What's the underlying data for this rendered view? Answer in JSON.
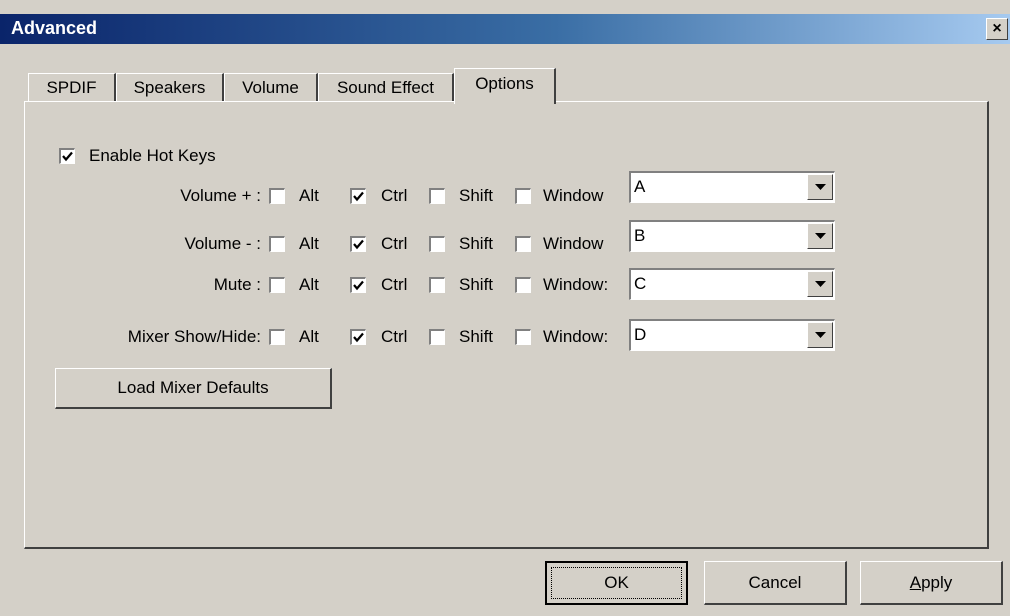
{
  "window": {
    "title": "Advanced",
    "close_glyph": "×"
  },
  "tabs": [
    {
      "label": "SPDIF",
      "active": false
    },
    {
      "label": "Speakers",
      "active": false
    },
    {
      "label": "Volume",
      "active": false
    },
    {
      "label": "Sound Effect",
      "active": false
    },
    {
      "label": "Options",
      "active": true
    }
  ],
  "options": {
    "enable_hot_keys": {
      "label": "Enable Hot Keys",
      "checked": true
    },
    "modifier_labels": {
      "alt": "Alt",
      "ctrl": "Ctrl",
      "shift": "Shift"
    },
    "rows": [
      {
        "label": "Volume + :",
        "alt": false,
        "ctrl": true,
        "shift": false,
        "window": false,
        "window_label": "Window",
        "key": "A"
      },
      {
        "label": "Volume - :",
        "alt": false,
        "ctrl": true,
        "shift": false,
        "window": false,
        "window_label": "Window",
        "key": "B"
      },
      {
        "label": "Mute :",
        "alt": false,
        "ctrl": true,
        "shift": false,
        "window": false,
        "window_label": "Window:",
        "key": "C"
      },
      {
        "label": "Mixer Show/Hide:",
        "alt": false,
        "ctrl": true,
        "shift": false,
        "window": false,
        "window_label": "Window:",
        "key": "D"
      }
    ],
    "load_defaults_label": "Load Mixer Defaults"
  },
  "footer": {
    "ok_label": "OK",
    "cancel_label": "Cancel",
    "apply_accel": "A",
    "apply_rest": "pply"
  },
  "colors": {
    "face": "#d4d0c8",
    "title_start": "#0a246a",
    "title_end": "#a6caf0"
  }
}
